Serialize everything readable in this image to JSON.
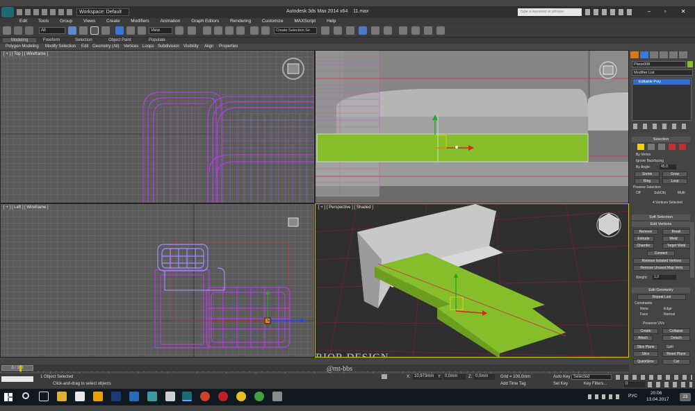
{
  "app": {
    "title": "Autodesk 3ds Max 2014 x64",
    "file": "11.max",
    "workspace": "Workspace: Default",
    "search_placeholder": "Type a keyword or phrase"
  },
  "menu": [
    "Edit",
    "Tools",
    "Group",
    "Views",
    "Create",
    "Modifiers",
    "Animation",
    "Graph Editors",
    "Rendering",
    "Customize",
    "MAXScript",
    "Help"
  ],
  "toolbar": {
    "filter": "All",
    "refcoord": "View",
    "named_selection": "Create Selection Se"
  },
  "ribbon": {
    "tabs": [
      "Modeling",
      "Freeform",
      "Selection",
      "Object Paint",
      "Populate"
    ],
    "row": [
      "Polygon Modeling",
      "Modify Selection",
      "Edit",
      "Geometry (All)",
      "Vertices",
      "Loops",
      "Subdivision",
      "Visibility",
      "Align",
      "Properties"
    ]
  },
  "viewports": {
    "top": "[ + ] [ Top ] [ Wireframe ]",
    "left": "[ + ] [ Left ] [ Wireframe ]",
    "perspective": "[ + ] [ Perspective ] [ Shaded ]"
  },
  "command_panel": {
    "object_name": "Plane008",
    "modifier_list": "Modifier List",
    "stack_item": "Editable Poly",
    "selection": {
      "title": "Selection",
      "by_vertex": "By Vertex",
      "ignore_backfacing": "Ignore Backfacing",
      "by_angle": "By Angle:",
      "angle": "45,0",
      "shrink": "Shrink",
      "grow": "Grow",
      "ring": "Ring",
      "loop": "Loop",
      "preview": "Preview Selection",
      "off": "Off",
      "subobj": "SubObj",
      "multi": "Multi",
      "status": "4 Vertices Selected"
    },
    "soft_selection": "Soft Selection",
    "edit_vertices": {
      "title": "Edit Vertices",
      "remove": "Remove",
      "break": "Break",
      "extrude": "Extrude",
      "weld": "Weld",
      "chamfer": "Chamfer",
      "target_weld": "Target Weld",
      "connect": "Connect",
      "remove_isolated": "Remove Isolated Vertices",
      "remove_unused": "Remove Unused Map Verts",
      "weight_label": "Weight:",
      "weight": "1,0"
    },
    "edit_geometry": {
      "title": "Edit Geometry",
      "repeat_last": "Repeat Last",
      "constraints": "Constraints",
      "none": "None",
      "edge": "Edge",
      "face": "Face",
      "normal": "Normal",
      "preserve_uvs": "Preserve UVs",
      "create": "Create",
      "collapse": "Collapse",
      "attach": "Attach",
      "detach": "Detach",
      "slice_plane": "Slice Plane",
      "split": "Split",
      "slice": "Slice",
      "reset_plane": "Reset Plane",
      "quickslice": "QuickSlice",
      "cut": "Cut"
    }
  },
  "timeline": {
    "frame": "0 / 100",
    "ticks": [
      "0",
      "5",
      "10",
      "15",
      "20",
      "25",
      "30",
      "35",
      "40",
      "45",
      "50",
      "55",
      "60",
      "65",
      "70",
      "75",
      "80",
      "85",
      "90",
      "95",
      "100"
    ]
  },
  "status": {
    "selected": "1 Object Selected",
    "prompt": "Click-and-drag to select objects",
    "x": "10,973mm",
    "y": "0,0mm",
    "z": "0,0mm",
    "grid": "Grid = 100,0mm",
    "auto_key": "Auto Key",
    "auto_key_value": "Selected",
    "set_key": "Set Key",
    "key_filters": "Key Filters...",
    "add_time_tag": "Add Time Tag",
    "frame": "0"
  },
  "taskbar": {
    "lang": "РУС",
    "time": "20:06",
    "date": "13.04.2017",
    "badge": "23"
  },
  "watermark": {
    "line1": "INTERIOR DESIGN",
    "line2": "@mt-bbs"
  },
  "colors": {
    "accent": "#3a78d8",
    "green": "#86bd2a",
    "wire": "#b040e0",
    "selected": "#2f6fd0"
  }
}
